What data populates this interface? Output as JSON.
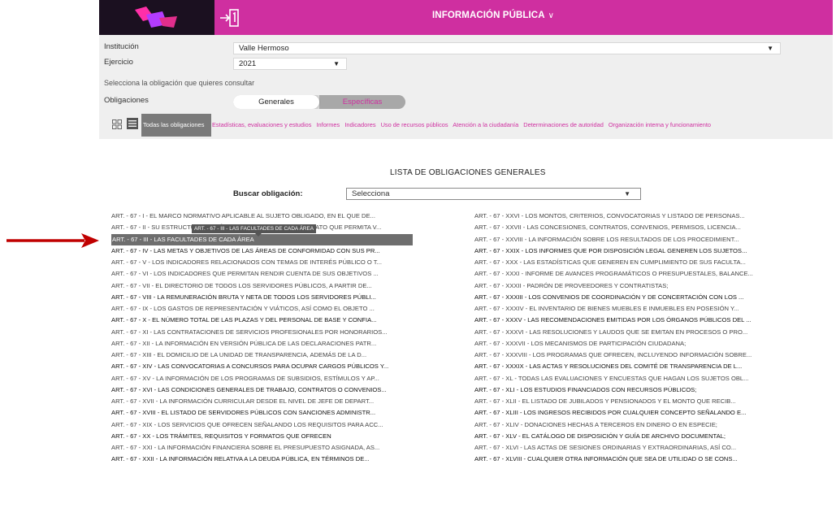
{
  "header": {
    "title": "INFORMACIÓN PÚBLICA",
    "brand_color": "#cf2fa0"
  },
  "filters": {
    "institucion_label": "Institución",
    "institucion_value": "Valle Hermoso",
    "ejercicio_label": "Ejercicio",
    "ejercicio_value": "2021",
    "hint": "Selecciona la obligación que quieres consultar",
    "obligaciones_label": "Obligaciones",
    "toggle_generales": "Generales",
    "toggle_especificas": "Específicas"
  },
  "categories": {
    "active": "Todas las obligaciones",
    "items": [
      "Estadísticas, evaluaciones y estudios",
      "Informes",
      "Indicadores",
      "Uso de recursos públicos",
      "Atención a la ciudadanía",
      "Determinaciones de autoridad",
      "Organización interna y funcionamiento"
    ]
  },
  "list": {
    "title": "LISTA DE OBLIGACIONES GENERALES",
    "search_label": "Buscar obligación:",
    "search_value": "Selecciona",
    "tooltip": "ART. - 67 - III - LAS FACULTADES DE CADA ÁREA",
    "left": [
      "ART. - 67 - I - EL MARCO NORMATIVO APLICABLE AL SUJETO OBLIGADO, EN EL QUE DE...",
      "ART. - 67 - II - SU ESTRUCTURA ORGÁNICA COMPLETA, EN UN FORMATO QUE PERMITA V...",
      "ART. - 67 - III - LAS FACULTADES DE CADA ÁREA",
      "ART. - 67 - IV - LAS METAS Y OBJETIVOS DE LAS ÁREAS DE CONFORMIDAD CON SUS PR...",
      "ART. - 67 - V - LOS INDICADORES RELACIONADOS CON TEMAS DE INTERÉS PÚBLICO O T...",
      "ART. - 67 - VI - LOS INDICADORES QUE PERMITAN RENDIR CUENTA DE SUS OBJETIVOS ...",
      "ART. - 67 - VII - EL DIRECTORIO DE TODOS LOS SERVIDORES PÚBLICOS, A PARTIR DE...",
      "ART. - 67 - VIII - LA REMUNERACIÓN BRUTA Y NETA DE TODOS LOS SERVIDORES PÚBLI...",
      "ART. - 67 - IX - LOS GASTOS DE REPRESENTACIÓN Y VIÁTICOS, ASÍ COMO EL OBJETO ...",
      "ART. - 67 - X - EL NÚMERO TOTAL DE LAS PLAZAS Y DEL PERSONAL DE BASE Y CONFIA...",
      "ART. - 67 - XI - LAS CONTRATACIONES DE SERVICIOS PROFESIONALES POR HONORARIOS...",
      "ART. - 67 - XII - LA INFORMACIÓN EN VERSIÓN PÚBLICA DE LAS DECLARACIONES PATR...",
      "ART. - 67 - XIII - EL DOMICILIO DE LA UNIDAD DE TRANSPARENCIA, ADEMÁS DE LA D...",
      "ART. - 67 - XIV - LAS CONVOCATORIAS A CONCURSOS PARA OCUPAR CARGOS PÚBLICOS Y...",
      "ART. - 67 - XV - LA INFORMACIÓN DE LOS PROGRAMAS DE SUBSIDIOS, ESTÍMULOS Y AP...",
      "ART. - 67 - XVI - LAS CONDICIONES GENERALES DE TRABAJO, CONTRATOS O CONVENIOS...",
      "ART. - 67 - XVII - LA INFORMACIÓN CURRICULAR DESDE EL NIVEL DE JEFE DE DEPART...",
      "ART. - 67 - XVIII - EL LISTADO DE SERVIDORES PÚBLICOS CON SANCIONES ADMINISTR...",
      "ART. - 67 - XIX - LOS SERVICIOS QUE OFRECEN SEÑALANDO LOS REQUISITOS PARA ACC...",
      "ART. - 67 - XX - LOS TRÁMITES, REQUISITOS Y FORMATOS QUE OFRECEN",
      "ART. - 67 - XXI - LA INFORMACIÓN FINANCIERA SOBRE EL PRESUPUESTO ASIGNADA, AS...",
      "ART. - 67 - XXII - LA INFORMACIÓN RELATIVA A LA DEUDA PÚBLICA, EN TÉRMINOS DE..."
    ],
    "right": [
      "ART. - 67 - XXVI - LOS MONTOS, CRITERIOS, CONVOCATORIAS Y LISTADO DE PERSONAS...",
      "ART. - 67 - XXVII - LAS CONCESIONES, CONTRATOS, CONVENIOS, PERMISOS, LICENCIA...",
      "ART. - 67 - XXVIII - LA INFORMACIÓN SOBRE LOS RESULTADOS DE LOS PROCEDIMIENT...",
      "ART. - 67 - XXIX - LOS INFORMES QUE POR DISPOSICIÓN LEGAL GENEREN LOS SUJETOS...",
      "ART. - 67 - XXX - LAS ESTADÍSTICAS QUE GENEREN EN CUMPLIMIENTO DE SUS FACULTA...",
      "ART. - 67 - XXXI - INFORME DE AVANCES PROGRAMÁTICOS O PRESUPUESTALES, BALANCE...",
      "ART. - 67 - XXXII - PADRÓN DE PROVEEDORES Y CONTRATISTAS;",
      "ART. - 67 - XXXIII - LOS CONVENIOS DE COORDINACIÓN Y DE CONCERTACIÓN CON LOS ...",
      "ART. - 67 - XXXIV - EL INVENTARIO DE BIENES MUEBLES E INMUEBLES EN POSESIÓN Y...",
      "ART. - 67 - XXXV - LAS RECOMENDACIONES EMITIDAS POR LOS ÓRGANOS PÚBLICOS DEL ...",
      "ART. - 67 - XXXVI - LAS RESOLUCIONES Y LAUDOS QUE SE EMITAN EN PROCESOS O PRO...",
      "ART. - 67 - XXXVII - LOS MECANISMOS DE PARTICIPACIÓN CIUDADANA;",
      "ART. - 67 - XXXVIII - LOS PROGRAMAS QUE OFRECEN, INCLUYENDO INFORMACIÓN SOBRE...",
      "ART. - 67 - XXXIX - LAS ACTAS Y RESOLUCIONES DEL COMITÉ DE TRANSPARENCIA DE L...",
      "ART. - 67 - XL - TODAS LAS EVALUACIONES Y ENCUESTAS QUE HAGAN LOS SUJETOS OBL...",
      "ART. - 67 - XLI - LOS ESTUDIOS FINANCIADOS CON RECURSOS PÚBLICOS;",
      "ART. - 67 - XLII - EL LISTADO DE JUBILADOS Y PENSIONADOS Y EL MONTO QUE RECIB...",
      "ART. - 67 - XLIII - LOS INGRESOS RECIBIDOS POR CUALQUIER CONCEPTO SEÑALANDO E...",
      "ART. - 67 - XLIV - DONACIONES HECHAS A TERCEROS EN DINERO O EN ESPECIE;",
      "ART. - 67 - XLV - EL CATÁLOGO DE DISPOSICIÓN Y GUÍA DE ARCHIVO DOCUMENTAL;",
      "ART. - 67 - XLVI - LAS ACTAS DE SESIONES ORDINARIAS Y EXTRAORDINARIAS, ASÍ CO...",
      "ART. - 67 - XLVIII - CUALQUIER OTRA INFORMACIÓN QUE SEA DE UTILIDAD O SE CONS..."
    ]
  }
}
